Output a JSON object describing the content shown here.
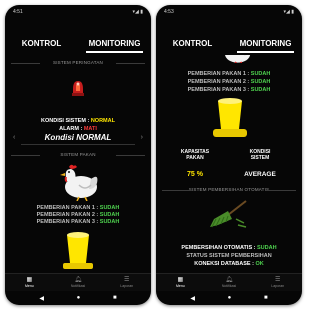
{
  "left_phone": {
    "status": {
      "time": "4:51",
      "right": "▾◢ ▮"
    },
    "tabs": [
      {
        "label": "KONTROL"
      },
      {
        "label": "MONITORING"
      }
    ],
    "sistem_peringatan": {
      "header": "SISTEM PERINGATAN",
      "kondisi_label": "KONDISI SISTEM :",
      "kondisi_value": "NORMAL",
      "alarm_label": "ALARM :",
      "alarm_value": "MATI",
      "kondisi_text": "Kondisi NORMAL"
    },
    "sistem_pakan": {
      "header": "SISTEM PAKAN",
      "rows": [
        {
          "label": "PEMBERIAN PAKAN 1 :",
          "value": "SUDAH"
        },
        {
          "label": "PEMBERIAN PAKAN 2 :",
          "value": "SUDAH"
        },
        {
          "label": "PEMBERIAN PAKAN 3 :",
          "value": "SUDAH"
        }
      ]
    },
    "bottom_nav": [
      {
        "label": "Menu"
      },
      {
        "label": "Notifikasi"
      },
      {
        "label": "Laporan"
      }
    ]
  },
  "right_phone": {
    "status": {
      "time": "4:53",
      "right": "▾◢ ▮"
    },
    "tabs": [
      {
        "label": "KONTROL"
      },
      {
        "label": "MONITORING"
      }
    ],
    "sistem_pakan": {
      "rows": [
        {
          "label": "PEMBERIAN PAKAN 1 :",
          "value": "SUDAH"
        },
        {
          "label": "PEMBERIAN PAKAN 2 :",
          "value": "SUDAH"
        },
        {
          "label": "PEMBERIAN PAKAN 3 :",
          "value": "SUDAH"
        }
      ],
      "kapasitas_label": "KAPASITAS PAKAN",
      "kondisi_label": "KONDISI SISTEM",
      "kapasitas_value": "75 %",
      "kondisi_value": "AVERAGE"
    },
    "sistem_pembersihan": {
      "header": "SISTEM PEMBERSIHAN OTOMATIS",
      "otomatis_label": "PEMBERSIHAN OTOMATIS :",
      "otomatis_value": "SUDAH",
      "status_text": "STATUS SISTEM PEMBERSIHAN",
      "koneksi_label": "KONEKSI DATABASE :",
      "koneksi_value": "OK"
    },
    "bottom_nav": [
      {
        "label": "Menu"
      },
      {
        "label": "Notifikasi"
      },
      {
        "label": "Laporan"
      }
    ]
  },
  "icons": {
    "alarm": "siren-icon",
    "chicken": "chicken-icon",
    "feeder": "feeder-icon",
    "broom": "broom-icon",
    "menu": "grid-icon",
    "notif": "bell-icon",
    "report": "list-icon"
  },
  "colors": {
    "background": "#060606",
    "ok": "#4fd34f",
    "alarm": "#ff3b3b",
    "feeder": "#ffe600",
    "broom": "#4a8c2a"
  }
}
